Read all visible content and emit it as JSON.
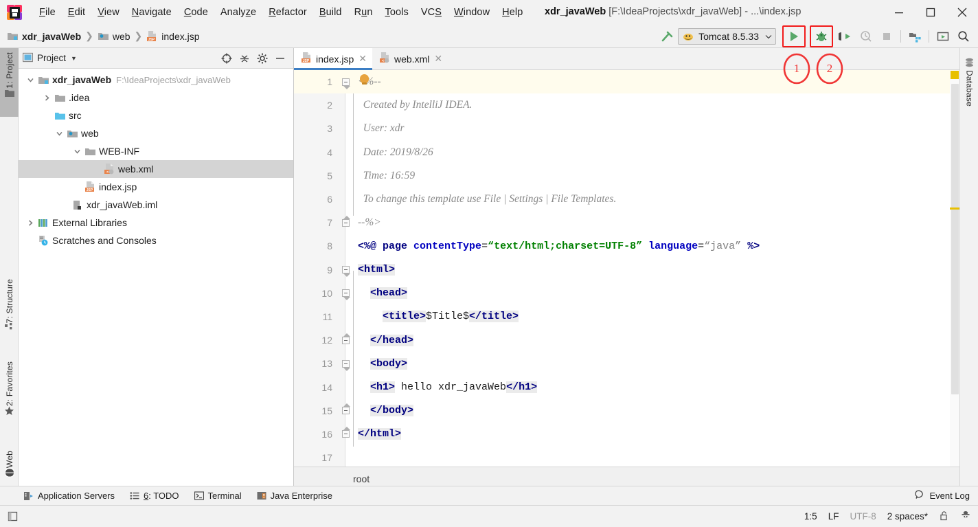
{
  "window": {
    "app_icon": "intellij-idea-logo",
    "title_project": "xdr_javaWeb",
    "title_path": "[F:\\IdeaProjects\\xdr_javaWeb] - ...\\index.jsp",
    "minimize": "–",
    "maximize": "☐",
    "close": "✕"
  },
  "menubar": [
    {
      "label": "File",
      "mnemonic": "F"
    },
    {
      "label": "Edit",
      "mnemonic": "E"
    },
    {
      "label": "View",
      "mnemonic": "V"
    },
    {
      "label": "Navigate",
      "mnemonic": "N"
    },
    {
      "label": "Code",
      "mnemonic": "C"
    },
    {
      "label": "Analyze",
      "mnemonic": "z"
    },
    {
      "label": "Refactor",
      "mnemonic": "R"
    },
    {
      "label": "Build",
      "mnemonic": "B"
    },
    {
      "label": "Run",
      "mnemonic": "u"
    },
    {
      "label": "Tools",
      "mnemonic": "T"
    },
    {
      "label": "VCS",
      "mnemonic": "S"
    },
    {
      "label": "Window",
      "mnemonic": "W"
    },
    {
      "label": "Help",
      "mnemonic": "H"
    }
  ],
  "toolbar": {
    "breadcrumbs": [
      {
        "label": "xdr_javaWeb",
        "icon": "module-folder-icon",
        "bold": true
      },
      {
        "label": "web",
        "icon": "web-folder-icon",
        "bold": false
      },
      {
        "label": "index.jsp",
        "icon": "jsp-file-icon",
        "bold": false
      }
    ],
    "separator": "❯",
    "build_icon": "build-hammer-icon",
    "run_config": {
      "name": "Tomcat 8.5.33",
      "icon": "tomcat-icon",
      "dropdown": "⌄"
    },
    "run_button": "run-button",
    "debug_button": "debug-button",
    "run_with_coverage_button": "run-with-coverage-button",
    "profile_button": "profile-button",
    "stop_button": "stop-button",
    "project_structure_button": "project-structure-button",
    "update_app_button": "update-application-button",
    "search_button": "search-everywhere-button",
    "highlight_color": "#f21b1b"
  },
  "annotations": [
    {
      "label": "1",
      "target": "run-button"
    },
    {
      "label": "2",
      "target": "debug-button"
    }
  ],
  "left_tool_strip": [
    {
      "label": "1: Project",
      "icon": "project-folder-icon",
      "active": true
    },
    {
      "label": "7: Structure",
      "icon": "structure-icon",
      "active": false
    },
    {
      "label": "2: Favorites",
      "icon": "star-icon",
      "active": false
    },
    {
      "label": "Web",
      "icon": "globe-icon",
      "active": false
    }
  ],
  "right_tool_strip": [
    {
      "label": "Database",
      "icon": "database-icon",
      "active": false
    }
  ],
  "project_panel": {
    "title": "Project",
    "dropdown": "▾",
    "icon": "project-view-icon",
    "buttons": [
      {
        "name": "locate-file-button",
        "icon": "crosshair-icon"
      },
      {
        "name": "collapse-all-button",
        "icon": "collapse-icon"
      },
      {
        "name": "settings-button",
        "icon": "gear-icon"
      },
      {
        "name": "hide-button",
        "icon": "minus-icon"
      }
    ],
    "tree": [
      {
        "label": "xdr_javaWeb",
        "sub": "F:\\IdeaProjects\\xdr_javaWeb",
        "icon": "module-folder-icon",
        "indent": 0,
        "arrow": "expanded",
        "bold": true,
        "selected": false
      },
      {
        "label": ".idea",
        "sub": "",
        "icon": "folder-icon",
        "indent": 1,
        "arrow": "collapsed",
        "bold": false,
        "selected": false
      },
      {
        "label": "src",
        "sub": "",
        "icon": "source-folder-icon",
        "indent": 1,
        "arrow": "none",
        "bold": false,
        "selected": false
      },
      {
        "label": "web",
        "sub": "",
        "icon": "web-folder-icon",
        "indent": 1,
        "arrow": "expanded",
        "bold": false,
        "selected": false
      },
      {
        "label": "WEB-INF",
        "sub": "",
        "icon": "folder-icon",
        "indent": 2,
        "arrow": "expanded",
        "bold": false,
        "selected": false
      },
      {
        "label": "web.xml",
        "sub": "",
        "icon": "xml-file-icon",
        "indent": 3,
        "arrow": "none",
        "bold": false,
        "selected": true
      },
      {
        "label": "index.jsp",
        "sub": "",
        "icon": "jsp-file-icon",
        "indent": 2,
        "arrow": "none",
        "bold": false,
        "selected": false
      },
      {
        "label": "xdr_javaWeb.iml",
        "sub": "",
        "icon": "iml-file-icon",
        "indent": 1,
        "arrow": "none",
        "bold": false,
        "selected": false
      },
      {
        "label": "External Libraries",
        "sub": "",
        "icon": "libraries-icon",
        "indent": 0,
        "arrow": "collapsed",
        "bold": false,
        "selected": false
      },
      {
        "label": "Scratches and Consoles",
        "sub": "",
        "icon": "scratches-icon",
        "indent": 0,
        "arrow": "none",
        "bold": false,
        "selected": false
      }
    ]
  },
  "editor": {
    "tabs": [
      {
        "label": "index.jsp",
        "icon": "jsp-file-icon",
        "active": true,
        "close": "✕"
      },
      {
        "label": "web.xml",
        "icon": "xml-file-icon",
        "active": false,
        "close": "✕"
      }
    ],
    "breadcrumb_bottom": "root",
    "intention_bulb": "intention-bulb-icon",
    "lines": [
      {
        "n": "1",
        "highlight": true,
        "fold": "start-top",
        "tokens": [
          {
            "t": "<%--",
            "c": "tk-comment"
          }
        ]
      },
      {
        "n": "2",
        "highlight": false,
        "fold": "line",
        "tokens": [
          {
            "t": "  Created by IntelliJ IDEA.",
            "c": "tk-comment"
          }
        ]
      },
      {
        "n": "3",
        "highlight": false,
        "fold": "line",
        "tokens": [
          {
            "t": "  User: xdr",
            "c": "tk-comment"
          }
        ]
      },
      {
        "n": "4",
        "highlight": false,
        "fold": "line",
        "tokens": [
          {
            "t": "  Date: 2019/8/26",
            "c": "tk-comment"
          }
        ]
      },
      {
        "n": "5",
        "highlight": false,
        "fold": "line",
        "tokens": [
          {
            "t": "  Time: 16:59",
            "c": "tk-comment"
          }
        ]
      },
      {
        "n": "6",
        "highlight": false,
        "fold": "line",
        "tokens": [
          {
            "t": "  To change this template use File | Settings | File Templates.",
            "c": "tk-comment"
          }
        ]
      },
      {
        "n": "7",
        "highlight": false,
        "fold": "end-bottom",
        "tokens": [
          {
            "t": "--%>",
            "c": "tk-comment"
          }
        ]
      },
      {
        "n": "8",
        "highlight": false,
        "fold": "none",
        "tokens": [
          {
            "t": "<%@ ",
            "c": "tk-dir"
          },
          {
            "t": "page ",
            "c": "tk-dir"
          },
          {
            "t": "contentType",
            "c": "tk-attr"
          },
          {
            "t": "=",
            "c": "tk-plain"
          },
          {
            "t": "“text/html;charset=UTF-8”",
            "c": "tk-str"
          },
          {
            "t": " ",
            "c": "tk-plain"
          },
          {
            "t": "language",
            "c": "tk-attr"
          },
          {
            "t": "=",
            "c": "tk-plain"
          },
          {
            "t": "“java”",
            "c": "tk-str2"
          },
          {
            "t": " %>",
            "c": "tk-dir"
          }
        ]
      },
      {
        "n": "9",
        "highlight": false,
        "fold": "start-top",
        "tokens": [
          {
            "t": "<html>",
            "c": "tk-tag bg-tag"
          }
        ]
      },
      {
        "n": "10",
        "highlight": false,
        "fold": "start-top",
        "tokens": [
          {
            "t": "  ",
            "c": "tk-plain"
          },
          {
            "t": "<head>",
            "c": "tk-tag bg-tag"
          }
        ]
      },
      {
        "n": "11",
        "highlight": false,
        "fold": "none",
        "tokens": [
          {
            "t": "    ",
            "c": "tk-plain"
          },
          {
            "t": "<title>",
            "c": "tk-tag bg-tag"
          },
          {
            "t": "$Title$",
            "c": "tk-plain"
          },
          {
            "t": "</title>",
            "c": "tk-tag bg-tag"
          }
        ]
      },
      {
        "n": "12",
        "highlight": false,
        "fold": "end-bottom",
        "tokens": [
          {
            "t": "  ",
            "c": "tk-plain"
          },
          {
            "t": "</head>",
            "c": "tk-tag bg-tag"
          }
        ]
      },
      {
        "n": "13",
        "highlight": false,
        "fold": "start-top",
        "tokens": [
          {
            "t": "  ",
            "c": "tk-plain"
          },
          {
            "t": "<body>",
            "c": "tk-tag bg-tag"
          }
        ]
      },
      {
        "n": "14",
        "highlight": false,
        "fold": "none",
        "tokens": [
          {
            "t": "  ",
            "c": "tk-plain"
          },
          {
            "t": "<h1>",
            "c": "tk-tag bg-tag"
          },
          {
            "t": " hello xdr_javaWeb",
            "c": "tk-plain"
          },
          {
            "t": "</h1>",
            "c": "tk-tag bg-tag"
          }
        ]
      },
      {
        "n": "15",
        "highlight": false,
        "fold": "end-bottom",
        "tokens": [
          {
            "t": "  ",
            "c": "tk-plain"
          },
          {
            "t": "</body>",
            "c": "tk-tag bg-tag"
          }
        ]
      },
      {
        "n": "16",
        "highlight": false,
        "fold": "end-bottom",
        "tokens": [
          {
            "t": "</html>",
            "c": "tk-tag bg-tag"
          }
        ]
      },
      {
        "n": "17",
        "highlight": false,
        "fold": "none",
        "tokens": [
          {
            "t": "",
            "c": "tk-plain"
          }
        ]
      }
    ]
  },
  "tool_window_bar": {
    "items": [
      {
        "label": "Application Servers",
        "icon": "application-servers-icon",
        "mnemonic": ""
      },
      {
        "label": "6: TODO",
        "icon": "todo-icon",
        "mnemonic": "6"
      },
      {
        "label": "Terminal",
        "icon": "terminal-icon",
        "mnemonic": ""
      },
      {
        "label": "Java Enterprise",
        "icon": "java-enterprise-icon",
        "mnemonic": ""
      }
    ],
    "event_log": {
      "label": "Event Log",
      "icon": "event-log-icon"
    }
  },
  "statusbar": {
    "left_icon": "toggle-toolwindow-icon",
    "cells": [
      {
        "label": "1:5",
        "dim": false,
        "name": "caret-position"
      },
      {
        "label": "LF",
        "dim": false,
        "name": "line-separator"
      },
      {
        "label": "UTF-8",
        "dim": true,
        "name": "file-encoding"
      },
      {
        "label": "2 spaces*",
        "dim": false,
        "name": "indent-setting"
      }
    ],
    "lock_icon": "unlocked-icon",
    "inspector_icon": "hector-inspection-icon"
  }
}
